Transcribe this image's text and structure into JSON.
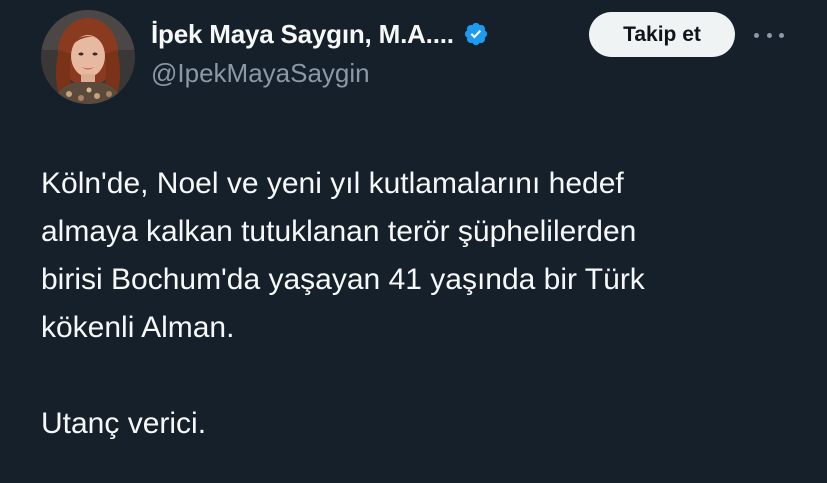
{
  "author": {
    "display_name": "İpek Maya Saygın, M.A....",
    "handle": "@IpekMayaSaygin",
    "verified_color": "#1d9bf0"
  },
  "actions": {
    "follow_label": "Takip et"
  },
  "icons": {
    "avatar": "profile-photo",
    "verified": "verified-badge-icon",
    "more": "more-options-icon"
  },
  "tweet": {
    "lines": [
      "Köln'de, Noel ve yeni yıl kutlamalarını hedef",
      "almaya kalkan tutuklanan terör şüphelilerden",
      "birisi Bochum'da yaşayan 41 yaşında bir Türk",
      "kökenli Alman."
    ],
    "closing": "Utanç verici."
  }
}
